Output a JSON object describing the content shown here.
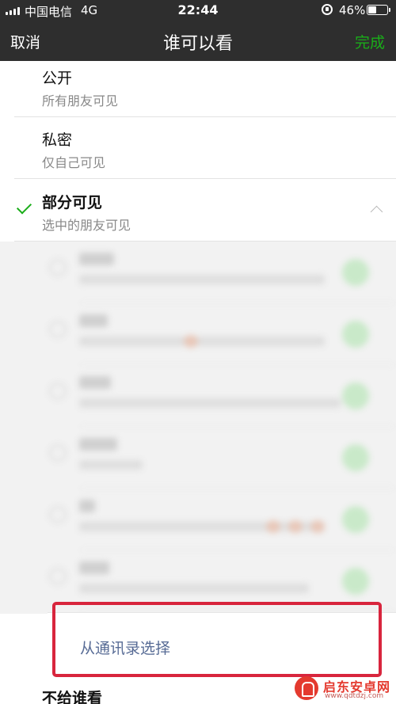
{
  "status_bar": {
    "carrier": "中国电信",
    "network": "4G",
    "time": "22:44",
    "battery_percent": "46%",
    "battery_level": 0.46,
    "icons": [
      "signal-icon",
      "rotation-lock-icon",
      "battery-icon"
    ]
  },
  "nav": {
    "cancel": "取消",
    "title": "谁可以看",
    "done": "完成",
    "done_color": "#1aad19"
  },
  "options": [
    {
      "title": "公开",
      "subtitle": "所有朋友可见"
    },
    {
      "title": "私密",
      "subtitle": "仅自己可见"
    },
    {
      "title": "部分可见",
      "subtitle": "选中的朋友可见",
      "selected": true,
      "expanded": true
    }
  ],
  "select_from_contacts": "从通讯录选择",
  "link_color": "#576b95",
  "hide_from": {
    "title": "不给谁看"
  },
  "watermark": {
    "title": "启东安卓网",
    "url": "www.qdtdzj.com"
  },
  "accent_color": "#1aad19",
  "highlight_color": "#d8253d"
}
